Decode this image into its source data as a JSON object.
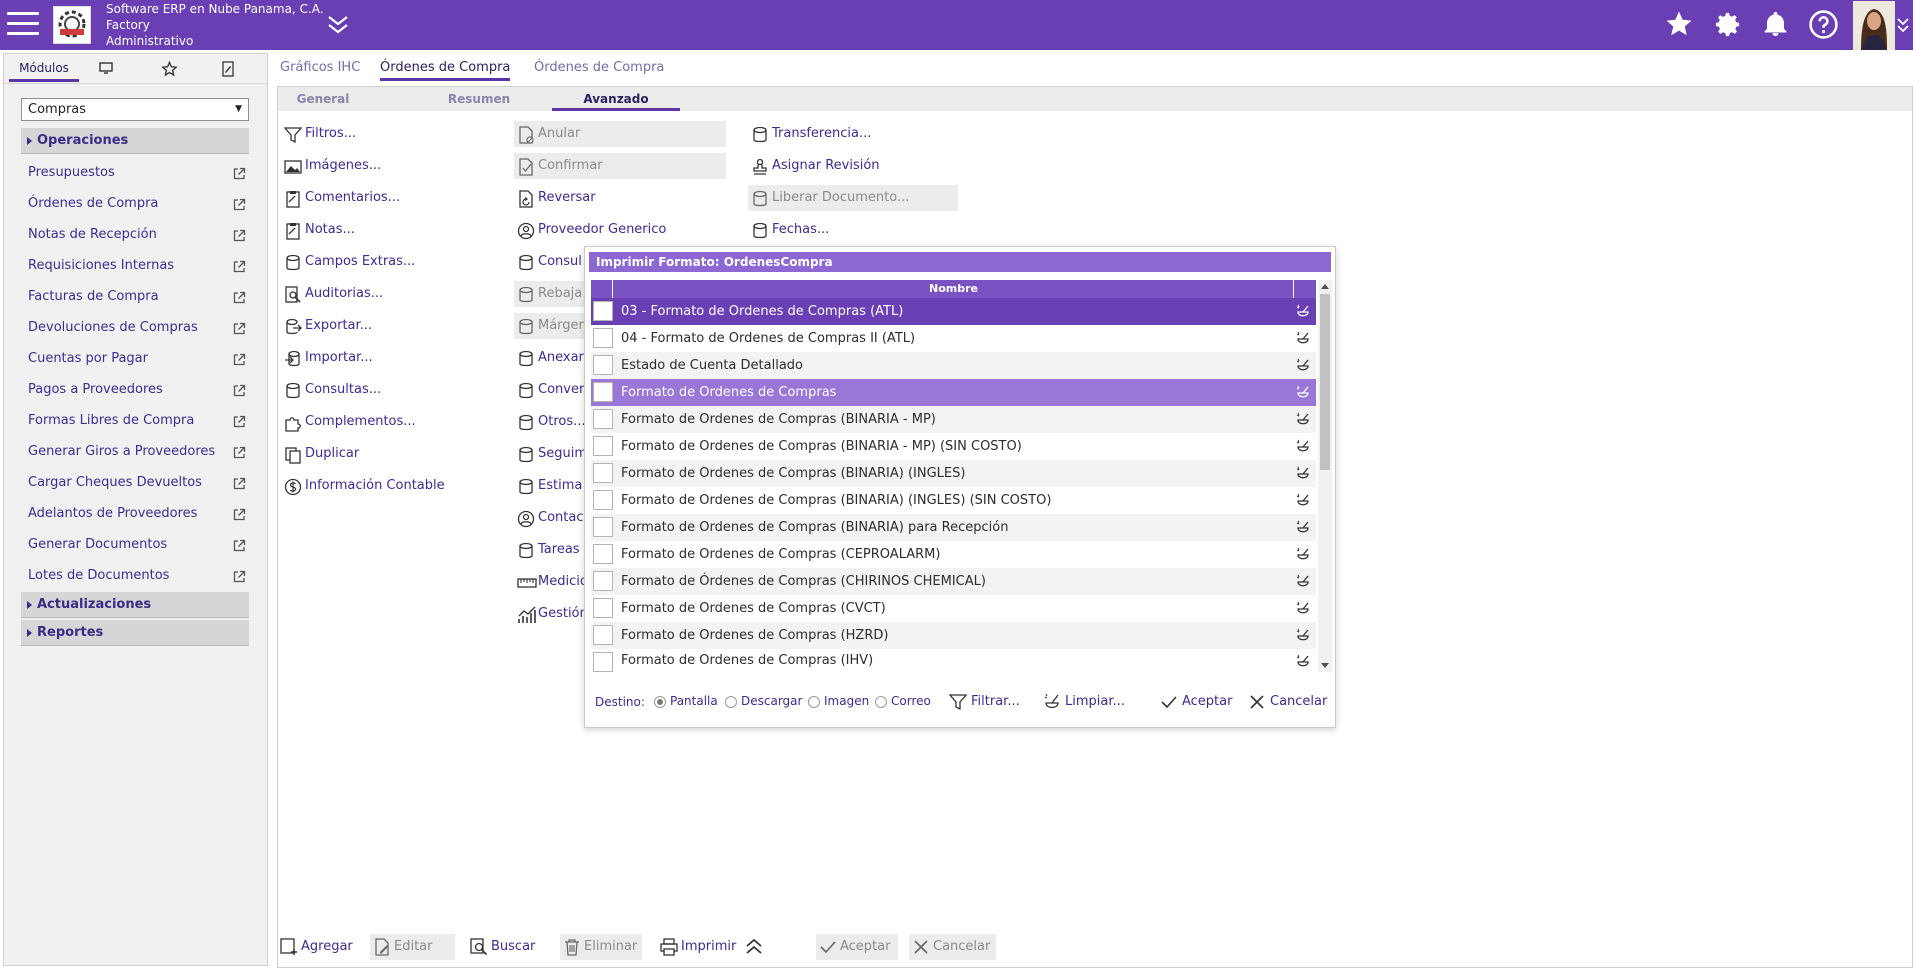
{
  "header": {
    "company": "Software ERP en Nube Panama, C.A.",
    "database": "Factory",
    "role": "Administrativo",
    "brand_color": "#6a3fb4"
  },
  "sidebar": {
    "tabs": {
      "modulos": "Módulos"
    },
    "module_select": "Compras",
    "sections": {
      "operaciones": "Operaciones",
      "actualizaciones": "Actualizaciones",
      "reportes": "Reportes"
    },
    "items": [
      "Presupuestos",
      "Órdenes de Compra",
      "Notas de Recepción",
      "Requisiciones Internas",
      "Facturas de Compra",
      "Devoluciones de Compras",
      "Cuentas por Pagar",
      "Pagos a Proveedores",
      "Formas Libres de Compra",
      "Generar Giros a Proveedores",
      "Cargar Cheques Devueltos",
      "Adelantos de Proveedores",
      "Generar Documentos",
      "Lotes de Documentos"
    ]
  },
  "main": {
    "tabs": [
      "Gráficos IHC",
      "Órdenes de Compra",
      "Órdenes de Compra"
    ],
    "subtabs": [
      "General",
      "Resumen",
      "Avanzado"
    ],
    "actions_col1": [
      "Filtros...",
      "Imágenes...",
      "Comentarios...",
      "Notas...",
      "Campos Extras...",
      "Auditorias...",
      "Exportar...",
      "Importar...",
      "Consultas...",
      "Complementos...",
      "Duplicar",
      "Información Contable"
    ],
    "actions_col2": [
      "Anular",
      "Confirmar",
      "Reversar",
      "Proveedor Generico",
      "Consul",
      "Rebaja",
      "Márger",
      "Anexar",
      "Conver",
      "Otros...",
      "Seguim",
      "Estima",
      "Contac",
      "Tareas",
      "Medicio",
      "Gestión"
    ],
    "actions_col3": [
      "Transferencia...",
      "Asignar Revisión",
      "Liberar Documento...",
      "Fechas..."
    ]
  },
  "toolbar": {
    "agregar": "Agregar",
    "editar": "Editar",
    "buscar": "Buscar",
    "eliminar": "Eliminar",
    "imprimir": "Imprimir",
    "aceptar": "Aceptar",
    "cancelar": "Cancelar"
  },
  "dialog": {
    "title": "Imprimir Formato: OrdenesCompra",
    "column_header": "Nombre",
    "rows": [
      "03 - Formato de Ordenes de Compras (ATL)",
      "04 - Formato de Ordenes de Compras II (ATL)",
      "Estado de Cuenta Detallado",
      "Formato de Ordenes de Compras",
      "Formato de Ordenes de Compras (BINARIA - MP)",
      "Formato de Ordenes de Compras (BINARIA - MP) (SIN COSTO)",
      "Formato de Ordenes de Compras (BINARIA) (INGLES)",
      "Formato de Ordenes de Compras (BINARIA) (INGLES) (SIN COSTO)",
      "Formato de Ordenes de Compras (BINARIA) para Recepción",
      "Formato de Ordenes de Compras (CEPROALARM)",
      "Formato de Órdenes de Compras (CHIRINOS CHEMICAL)",
      "Formato de Ordenes de Compras (CVCT)",
      "Formato de Ordenes de Compras (HZRD)",
      "Formato de Ordenes de Compras (IHV)"
    ],
    "destino_label": "Destino:",
    "destinations": [
      "Pantalla",
      "Descargar",
      "Imagen",
      "Correo"
    ],
    "selected_destination": "Pantalla",
    "filtrar": "Filtrar...",
    "limpiar": "Limpiar...",
    "aceptar": "Aceptar",
    "cancelar": "Cancelar"
  }
}
